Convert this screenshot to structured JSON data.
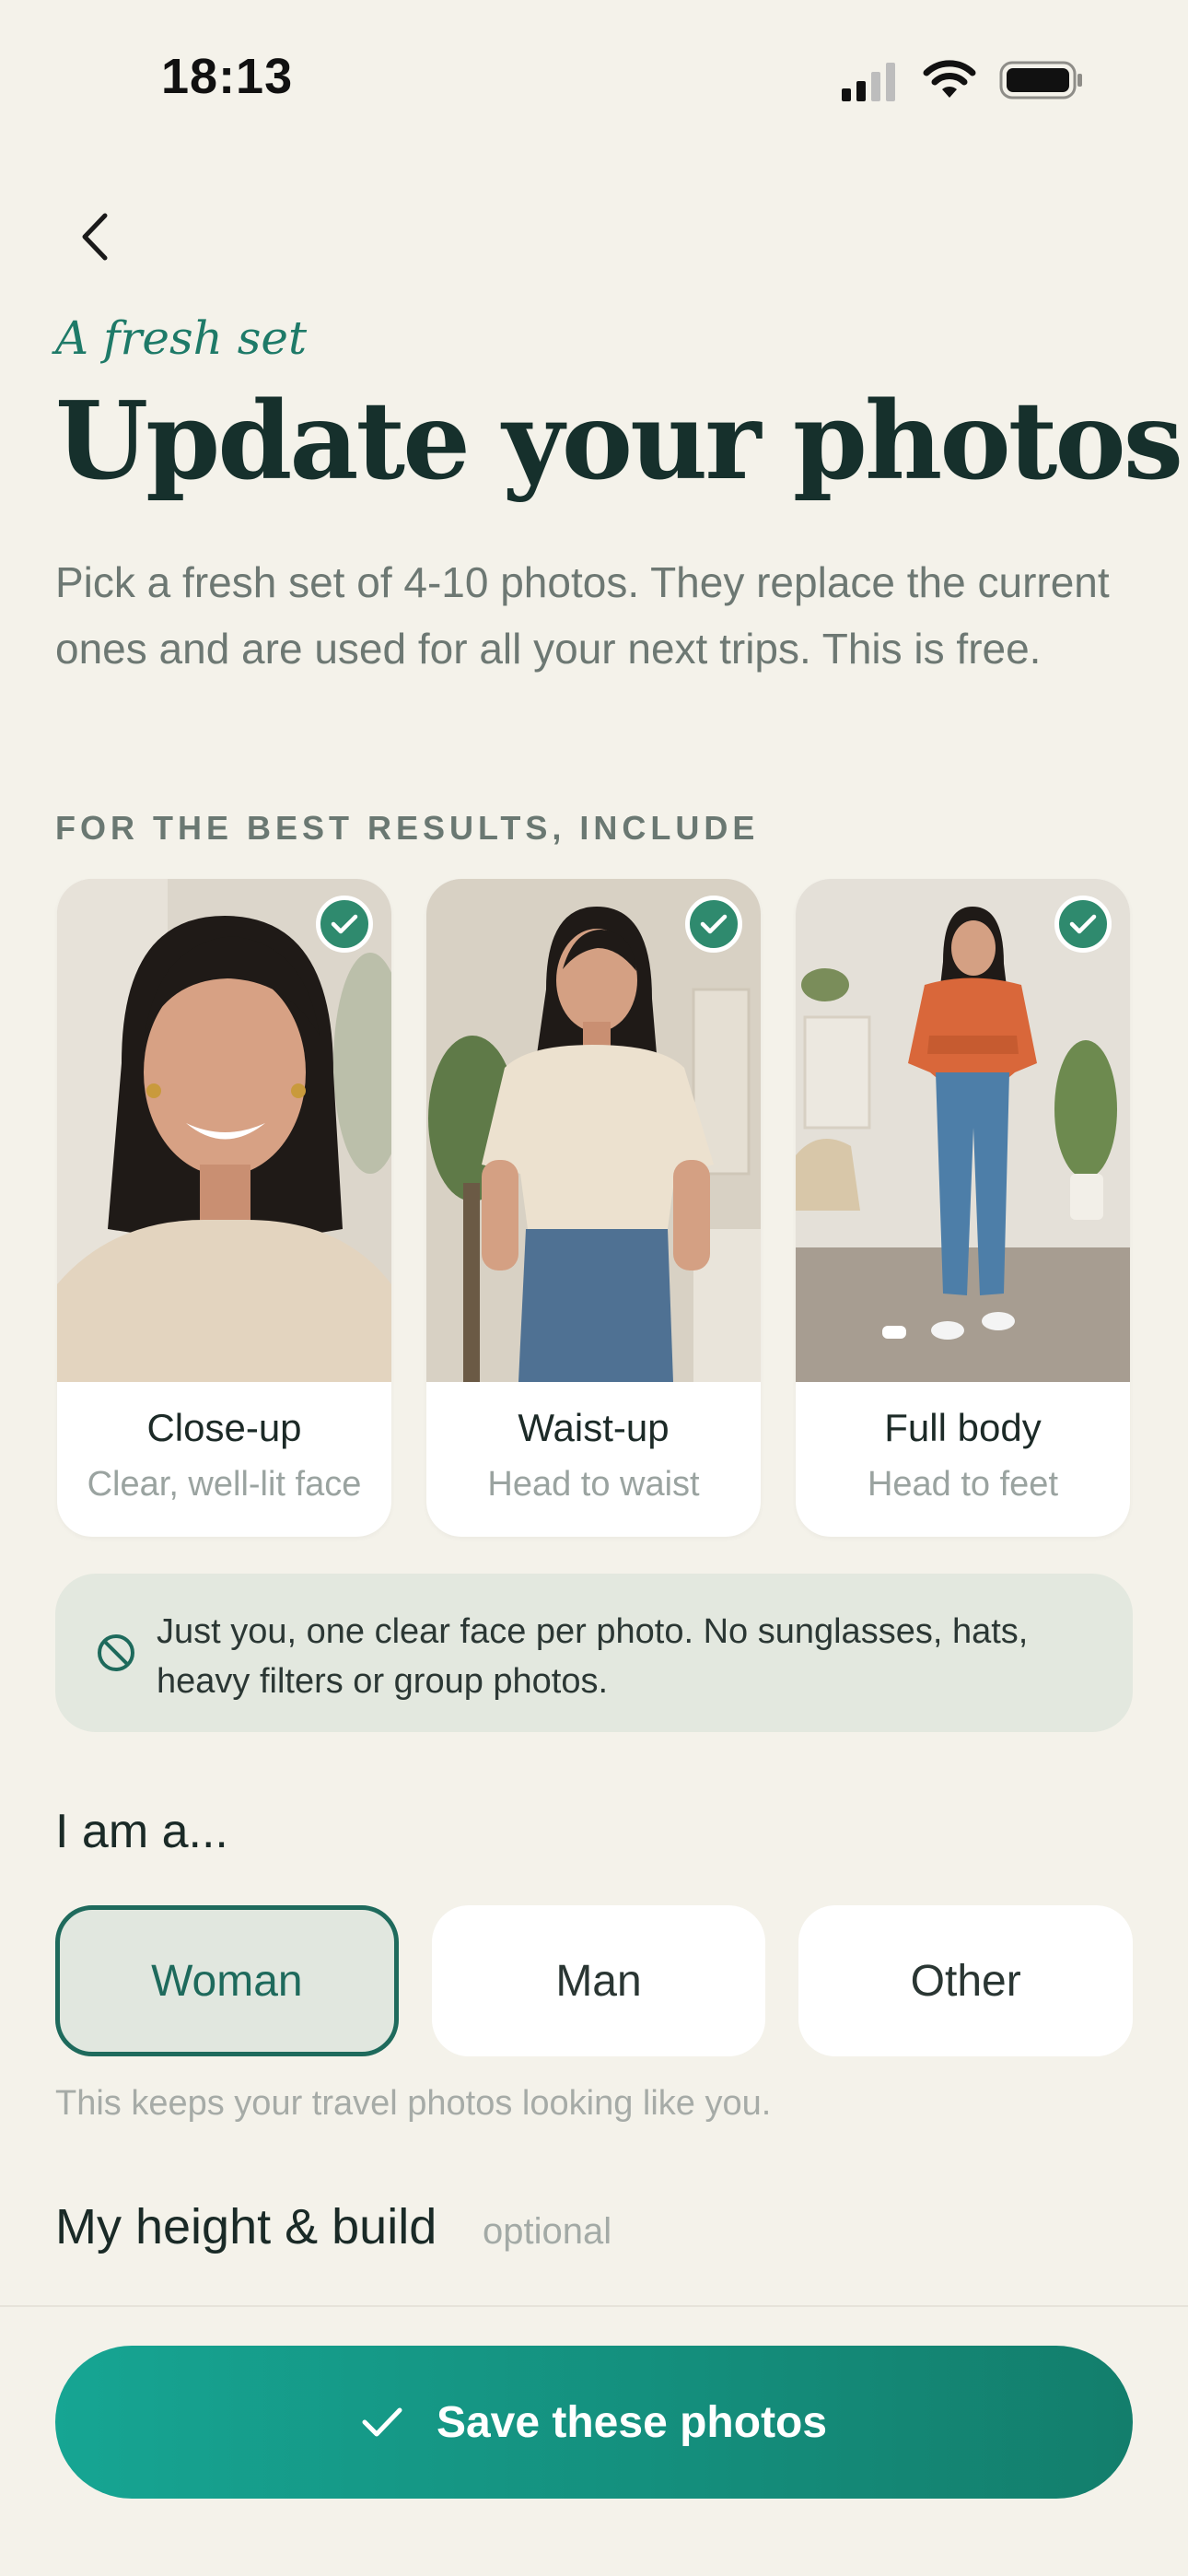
{
  "status_bar": {
    "time": "18:13"
  },
  "header": {
    "eyebrow": "A fresh set",
    "title": "Update your photos",
    "description": "Pick a fresh set of 4-10 photos. They replace the current ones and are used for all your next trips. This is free."
  },
  "examples": {
    "label": "FOR THE BEST RESULTS, INCLUDE",
    "cards": [
      {
        "title": "Close-up",
        "subtitle": "Clear, well-lit face"
      },
      {
        "title": "Waist-up",
        "subtitle": "Head to waist"
      },
      {
        "title": "Full body",
        "subtitle": "Head to feet"
      }
    ]
  },
  "notice": {
    "text": "Just you, one clear face per photo. No sunglasses, hats, heavy filters or group photos."
  },
  "gender": {
    "label": "I am a...",
    "options": [
      "Woman",
      "Man",
      "Other"
    ],
    "selected": "Woman",
    "hint": "This keeps your travel photos looking like you."
  },
  "height_build": {
    "label": "My height & build",
    "optional": "optional"
  },
  "save_button": {
    "label": "Save these photos"
  },
  "colors": {
    "accent": "#1e7a68",
    "button_start": "#16a593",
    "button_end": "#137e6c",
    "background": "#f4f2ea"
  }
}
